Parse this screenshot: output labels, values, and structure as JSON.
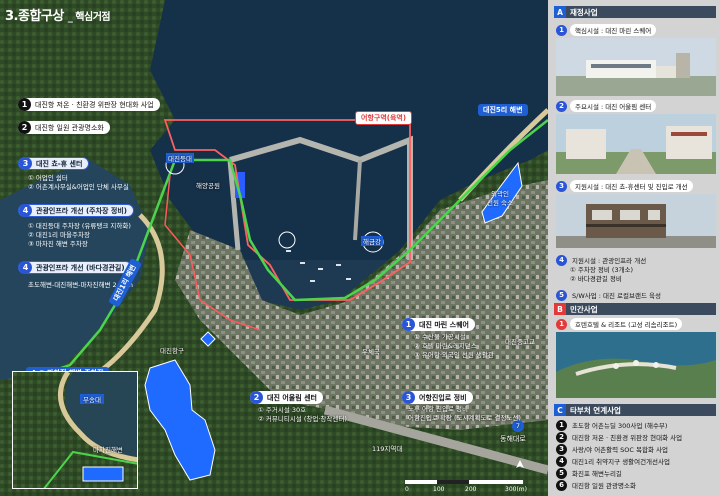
{
  "title": {
    "main": "3.종합구상",
    "sub": "_ 핵심거점"
  },
  "legend": [
    {
      "num": "1",
      "label": "대진항 저온 · 친환경 위판장 현대화 사업",
      "style": "white"
    },
    {
      "num": "2",
      "label": "대진항 일원 관광명소화",
      "style": "white"
    },
    {
      "num": "3",
      "label": "대진 쵸-휴 센터",
      "style": "blue",
      "subs": [
        "① 어업인 쉼터",
        "② 어촌계사무실&어업인 단체 사무실"
      ]
    },
    {
      "num": "4",
      "label": "관광인프라 개선 (주차장 정비)",
      "style": "blue",
      "subs": [
        "① 대진등대 주차장 (유류탱크 지하화)",
        "② 대진1리 마을주차장",
        "③ 마차진 해변 주차장"
      ]
    },
    {
      "num": "4",
      "label": "관광인프라 개선 (바다경관길)",
      "style": "blue",
      "subs": [
        "초도해변-대진해변-마차진해변 2.4km"
      ]
    }
  ],
  "map_labels": {
    "zone_pill": "어항구역(육역)",
    "dajin5": "대진5리 해변",
    "dajin1": "대진1리 해변",
    "machajin_parking": "4-③ 마차진 해변 주차장",
    "lighthouse": "대진등대",
    "haeyang_park": "해양공원",
    "haegeumgang": "해금강",
    "outer_zone": "외곽인\n선원 숙소",
    "daejin_port": "대진항구",
    "post_office": "우체국",
    "daejin_school": "대진중고교",
    "station_119": "119지역대",
    "donghae_road": "동해대로",
    "route_num": "7",
    "inset_label": "무송대",
    "inset_sub": "마차진해변"
  },
  "callouts": [
    {
      "num": "1",
      "label": "대진 마린 스퀘어",
      "subs": [
        "① 수산물 가공시설",
        "② 호텔 마린&레지던스",
        "③ 유어항·외국인 선원 생활관"
      ]
    },
    {
      "num": "2",
      "label": "대진 어울림 센터",
      "subs": [
        "① 주거시설 30호",
        "② 커뮤니티시설 (창업·창작센터)"
      ]
    },
    {
      "num": "3",
      "label": "어항진입로 정비",
      "subs": [
        "노후 어항 진입로 정비",
        "어항진입로 확장 (도시계획도로 결정노선)"
      ]
    }
  ],
  "scale": {
    "labels": [
      "0",
      "100",
      "200",
      "300(m)"
    ]
  },
  "panel": {
    "sectionA": {
      "letter": "A",
      "title": "재정사업"
    },
    "a_items": [
      {
        "num": "1",
        "label": "핵심시설 : 대진 마린 스퀘어"
      },
      {
        "num": "2",
        "label": "주요시설 : 대진 어울림 센터"
      },
      {
        "num": "3",
        "label": "지원시설 : 대진 쵸-휴센터 및 진입로 개선"
      },
      {
        "num": "4",
        "label": "지원시설 : 관광인프라 개선",
        "subs": [
          "① 주차장 정비 (3개소)",
          "② 바다경관길 정비"
        ]
      },
      {
        "num": "5",
        "label": "S/W사업 : 대진 로컬브랜드 육성"
      }
    ],
    "sectionB": {
      "letter": "B",
      "title": "민간사업"
    },
    "b_items": [
      {
        "num": "1",
        "label": "호텐호텔 & 리조트 (고성 리솜리조트)"
      }
    ],
    "sectionC": {
      "letter": "C",
      "title": "타부처 연계사업"
    },
    "c_items": [
      {
        "num": "1",
        "label": "초도항 어촌뉴딜 300사업 (해수부)"
      },
      {
        "num": "2",
        "label": "대진항 저온 · 친환경 위판장 현대화 사업"
      },
      {
        "num": "3",
        "label": "사랑/야 어촌활력 SOC 복합화 사업"
      },
      {
        "num": "4",
        "label": "대진1리 취약지구 생활여건개선사업"
      },
      {
        "num": "5",
        "label": "화진포 해변누리길"
      },
      {
        "num": "6",
        "label": "대진항 일원 관광명소화"
      }
    ]
  },
  "colors": {
    "accent_blue": "#2a55d6",
    "accent_red": "#e03a3a",
    "route_green": "#4cd44c",
    "route_red": "#ff5a5a",
    "sea": "#1d3a52",
    "panel_bg": "#d3d3d3"
  }
}
